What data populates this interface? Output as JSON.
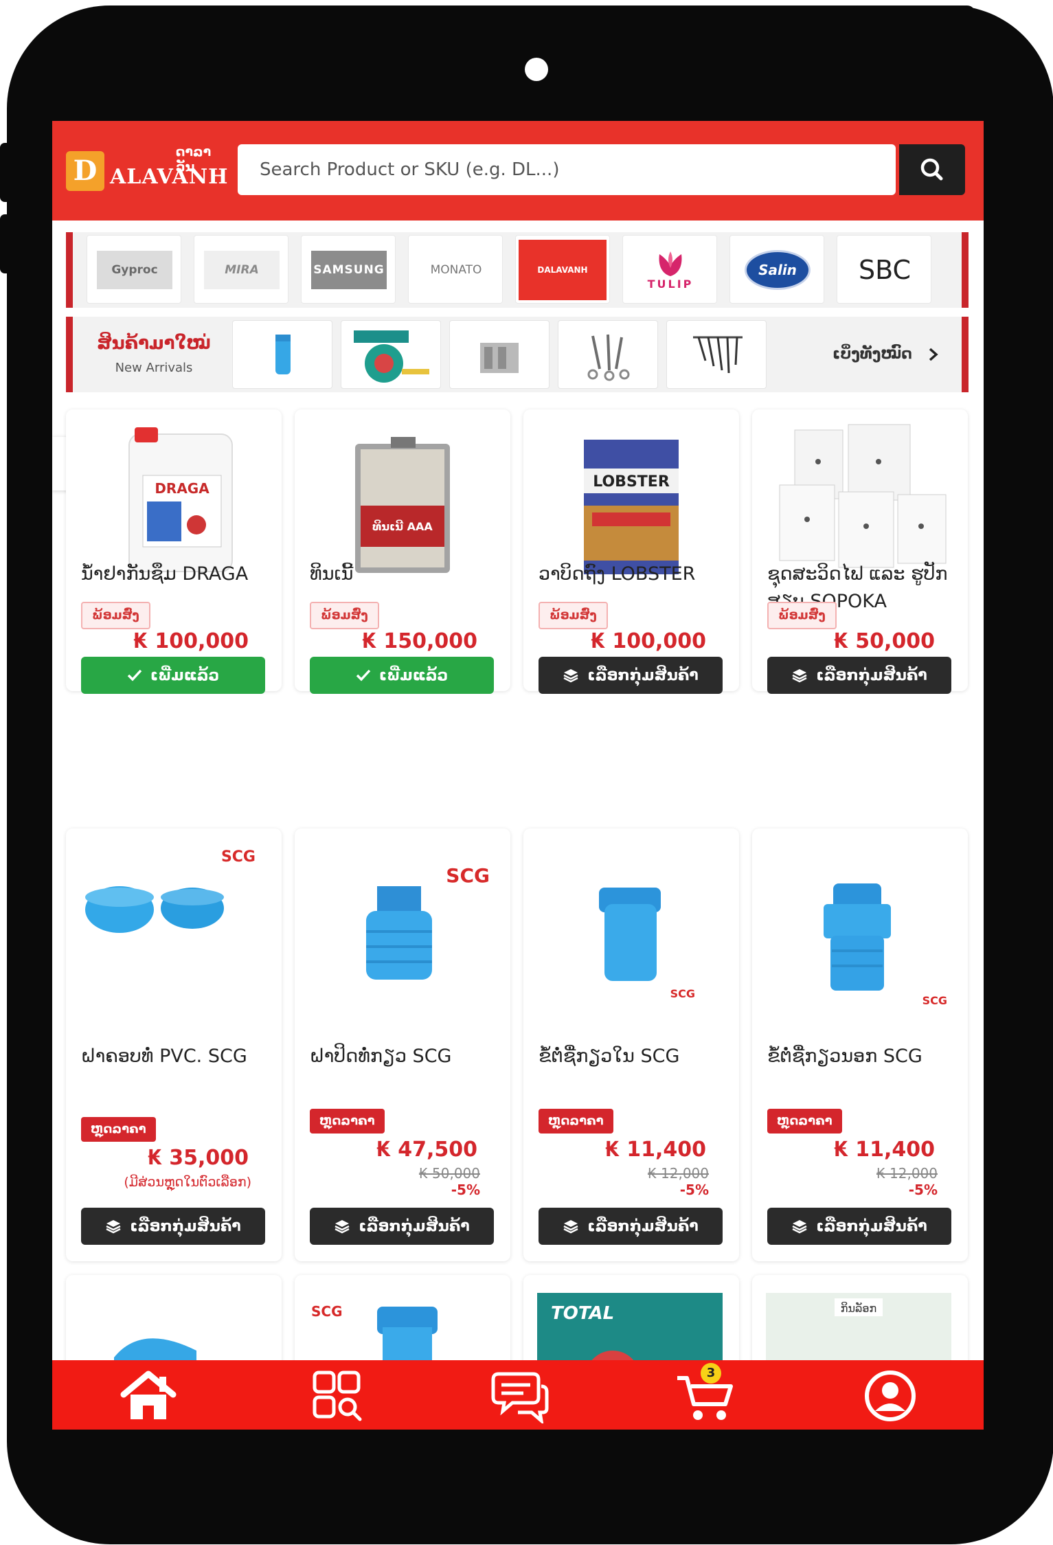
{
  "header": {
    "logo_lao": "ດາລາວັນ",
    "logo_letter": "D",
    "logo_text": "ALAVANH",
    "search_placeholder": "Search Product or SKU (e.g. DL...)"
  },
  "brands": [
    {
      "name": "Gyproc",
      "color": "#7a7a7a"
    },
    {
      "name": "MIRA",
      "color": "#888888"
    },
    {
      "name": "SAMSUNG",
      "color": "#ffffff"
    },
    {
      "name": "MONATO",
      "color": "#666666"
    },
    {
      "name": "DALAVANH",
      "color": "#ffffff"
    },
    {
      "name": "TULIP",
      "color": "#d6256b"
    },
    {
      "name": "Salin",
      "color": "#ffffff"
    },
    {
      "name": "SBC",
      "color": "#222222"
    }
  ],
  "arrivals": {
    "title_lao": "ສິນຄ້າມາໃໝ່",
    "title_en": "New Arrivals",
    "view_all": "ເບິ່ງທັງໝົດ"
  },
  "products": [
    {
      "name": "ນ້ຳຢາກັນຊຶມ DRAGA",
      "badge": "ພ້ອມສົ່ງ",
      "badge_type": "pre",
      "price": "₭ 100,000",
      "button": "ເພີ່ມແລ້ວ",
      "button_type": "added"
    },
    {
      "name": "ທິນເນີ້",
      "badge": "ພ້ອມສົ່ງ",
      "badge_type": "pre",
      "price": "₭ 150,000",
      "button": "ເພີ່ມແລ້ວ",
      "button_type": "added"
    },
    {
      "name": "ວາບິດຖົງ LOBSTER",
      "badge": "ພ້ອມສົ່ງ",
      "badge_type": "pre",
      "price": "₭ 100,000",
      "button": "ເລືອກກຸ່ມສິນຄ້າ",
      "button_type": "dark"
    },
    {
      "name": "ຊຸດສະວິດໄຟ ແລະ ຮູປັກ ສຽບ SOPOKA",
      "badge": "ພ້ອມສົ່ງ",
      "badge_type": "pre",
      "price": "₭ 50,000",
      "button": "ເລືອກກຸ່ມສິນຄ້າ",
      "button_type": "dark"
    },
    {
      "name": "ຝາຄອບທໍ່ PVC. SCG",
      "badge": "ຫຼຸດລາຄາ",
      "badge_type": "sale",
      "price": "₭ 35,000",
      "note": "(ມີສ່ວນຫຼຸດໃນຕົວເລືອກ)",
      "button": "ເລືອກກຸ່ມສິນຄ້າ",
      "button_type": "dark"
    },
    {
      "name": "ຝາປິດທໍ່ກຽວ SCG",
      "badge": "ຫຼຸດລາຄາ",
      "badge_type": "sale",
      "price": "₭ 47,500",
      "old_price": "₭ 50,000",
      "discount": "-5%",
      "button": "ເລືອກກຸ່ມສິນຄ້າ",
      "button_type": "dark"
    },
    {
      "name": "ຂໍ້ຕໍ່ຊື່ກຽວໃນ SCG",
      "badge": "ຫຼຸດລາຄາ",
      "badge_type": "sale",
      "price": "₭ 11,400",
      "old_price": "₭ 12,000",
      "discount": "-5%",
      "button": "ເລືອກກຸ່ມສິນຄ້າ",
      "button_type": "dark"
    },
    {
      "name": "ຂໍ້ຕໍ່ຊື່ກຽວນອກ SCG",
      "badge": "ຫຼຸດລາຄາ",
      "badge_type": "sale",
      "price": "₭ 11,400",
      "old_price": "₭ 12,000",
      "discount": "-5%",
      "button": "ເລືອກກຸ່ມສິນຄ້າ",
      "button_type": "dark"
    }
  ],
  "partial_row_labels": {
    "scg_logo": "SCG",
    "total_logo": "TOTAL",
    "last_tag": "ກິນລັອກ"
  },
  "product_image_labels": {
    "draga": "DRAGA",
    "thinner": "ທິນເນີ AAA",
    "lobster": "LOBSTER",
    "scg": "SCG"
  },
  "bottom_nav": {
    "cart_count": "3"
  },
  "colors": {
    "brand_red": "#e8322a",
    "nav_red": "#f11b14",
    "price_red": "#d4262c",
    "added_green": "#28a745",
    "dark_button": "#2b2b2b"
  }
}
